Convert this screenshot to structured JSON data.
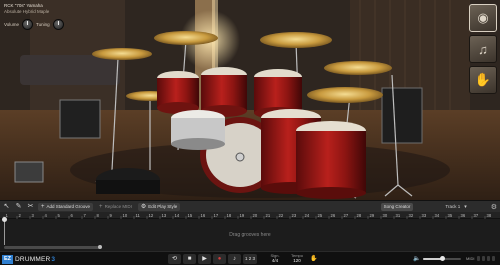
{
  "kit": {
    "name": "RCK \"70s\" Yamaha",
    "preset": "Absolute Hybrid Maple",
    "volume_label": "Volume",
    "tuning_label": "Tuning"
  },
  "thumbs": [
    {
      "icon": "snare-thumbnail-icon",
      "glyph": "◉",
      "active": true
    },
    {
      "icon": "kit-thumbnail-icon",
      "glyph": "♫",
      "active": false
    },
    {
      "icon": "hand-percussion-thumbnail-icon",
      "glyph": "✋",
      "active": false
    }
  ],
  "toolbar": {
    "add_groove_label": "Add Standard Groove",
    "replace_midi_label": "Replace MIDI",
    "edit_play_style_label": "Edit Play Style",
    "song_creator_label": "Song Creator",
    "track_label": "Track 1"
  },
  "ruler": {
    "numbers": [
      "1",
      "2",
      "3",
      "4",
      "5",
      "6",
      "7",
      "8",
      "9",
      "10",
      "11",
      "12",
      "13",
      "14",
      "15",
      "16",
      "17",
      "18",
      "19",
      "20",
      "21",
      "22",
      "23",
      "24",
      "25",
      "26",
      "27",
      "28",
      "29",
      "30",
      "31",
      "32",
      "33",
      "34",
      "35",
      "36",
      "37",
      "38"
    ]
  },
  "drag_area": {
    "hint": "Drag grooves here"
  },
  "transport": {
    "logo_ez": "EZ",
    "logo_name": "DRUMMER",
    "logo_version": "3",
    "buttons": [
      {
        "name": "loop-button",
        "glyph": "⟲"
      },
      {
        "name": "stop-button",
        "glyph": "■"
      },
      {
        "name": "play-button",
        "glyph": "▶"
      },
      {
        "name": "record-button",
        "glyph": "●"
      },
      {
        "name": "metronome-button",
        "glyph": "♪"
      },
      {
        "name": "count-in-button",
        "glyph": "1 2 3"
      }
    ],
    "sign_label": "Sign.",
    "sign_value": "4/4",
    "tempo_label": "Tempo",
    "tempo_value": "120",
    "midi_label": "MIDI"
  },
  "volume": {
    "level_percent": 52
  },
  "colors": {
    "accent": "#2f7fd0",
    "record": "#d33d3d"
  }
}
